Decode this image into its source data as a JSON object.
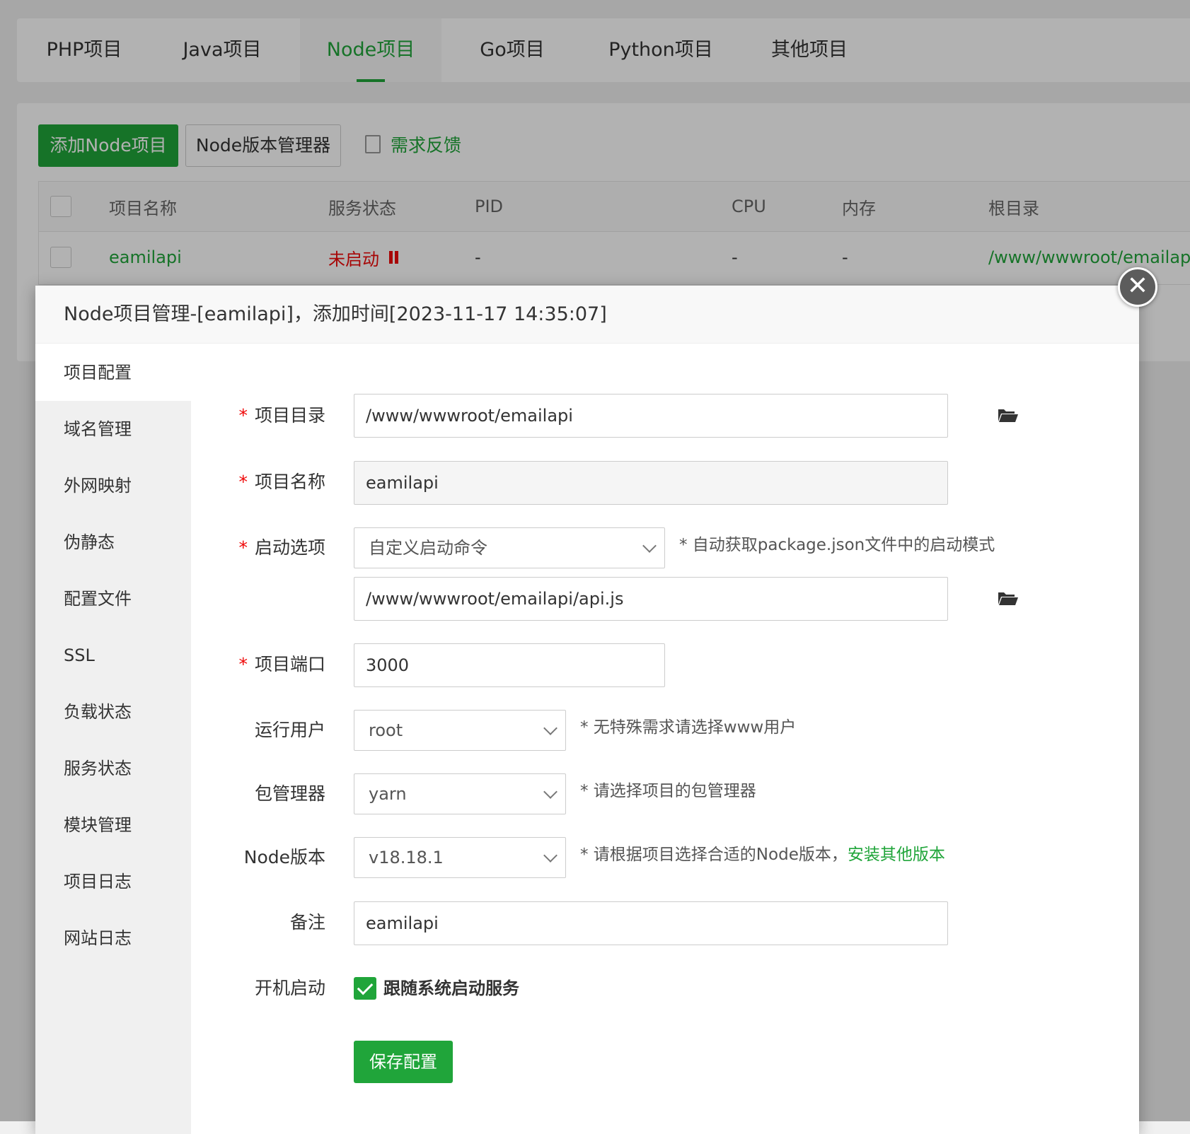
{
  "tabs": [
    {
      "label": "PHP项目"
    },
    {
      "label": "Java项目"
    },
    {
      "label": "Node项目"
    },
    {
      "label": "Go项目"
    },
    {
      "label": "Python项目"
    },
    {
      "label": "其他项目"
    }
  ],
  "active_tab": "Node项目",
  "toolbar": {
    "add_label": "添加Node项目",
    "version_manager_label": "Node版本管理器",
    "feedback_label": "需求反馈"
  },
  "table": {
    "headers": [
      "项目名称",
      "服务状态",
      "PID",
      "CPU",
      "内存",
      "根目录"
    ],
    "rows": [
      {
        "name": "eamilapi",
        "status": "未启动",
        "pid": "-",
        "cpu": "-",
        "memory": "-",
        "root": "/www/wwwroot/emailapi"
      }
    ]
  },
  "modal": {
    "title": "Node项目管理-[eamilapi]，添加时间[2023-11-17 14:35:07]",
    "sidebar": [
      {
        "label": "项目配置"
      },
      {
        "label": "域名管理"
      },
      {
        "label": "外网映射"
      },
      {
        "label": "伪静态"
      },
      {
        "label": "配置文件"
      },
      {
        "label": "SSL"
      },
      {
        "label": "负载状态"
      },
      {
        "label": "服务状态"
      },
      {
        "label": "模块管理"
      },
      {
        "label": "项目日志"
      },
      {
        "label": "网站日志"
      }
    ],
    "form": {
      "project_dir_label": "项目目录",
      "project_dir_value": "/www/wwwroot/emailapi",
      "project_name_label": "项目名称",
      "project_name_value": "eamilapi",
      "start_option_label": "启动选项",
      "start_option_value": "自定义启动命令",
      "start_option_hint": "* 自动获取package.json文件中的启动模式",
      "start_command_value": "/www/wwwroot/emailapi/api.js",
      "port_label": "项目端口",
      "port_value": "3000",
      "run_user_label": "运行用户",
      "run_user_value": "root",
      "run_user_hint": "* 无特殊需求请选择www用户",
      "pkg_manager_label": "包管理器",
      "pkg_manager_value": "yarn",
      "pkg_manager_hint": "* 请选择项目的包管理器",
      "node_version_label": "Node版本",
      "node_version_value": "v18.18.1",
      "node_version_hint": "* 请根据项目选择合适的Node版本，",
      "install_other_link": "安装其他版本",
      "remark_label": "备注",
      "remark_value": "eamilapi",
      "autostart_label": "开机启动",
      "autostart_checked": true,
      "autostart_text": "跟随系统启动服务",
      "save_label": "保存配置",
      "required_mark": "*"
    }
  },
  "colors": {
    "accent": "#20a53a",
    "danger": "#ef0808"
  }
}
